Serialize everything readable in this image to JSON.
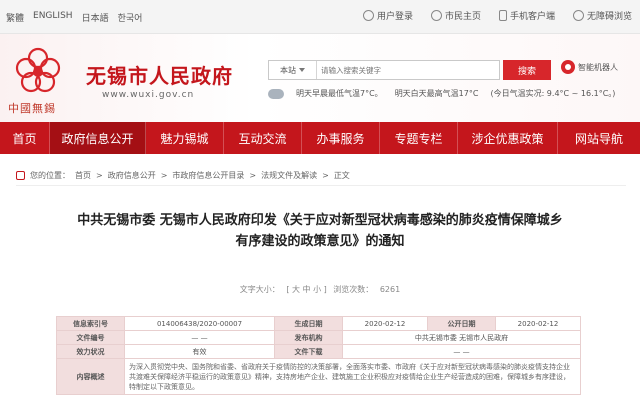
{
  "topbar": {
    "languages": [
      "繁體",
      "ENGLISH",
      "日本語",
      "한국어"
    ],
    "links": [
      {
        "label": "用户登录",
        "icon": "user-icon"
      },
      {
        "label": "市民主页",
        "icon": "home-icon"
      },
      {
        "label": "手机客户端",
        "icon": "phone-icon"
      },
      {
        "label": "无障碍浏览",
        "icon": "accessibility-icon"
      }
    ]
  },
  "header": {
    "logo_script": "中國無錫",
    "site_name": "无锡市人民政府",
    "site_url": "www.wuxi.gov.cn",
    "search_scope": "本站",
    "search_placeholder": "请输入搜索关键字",
    "search_button": "搜索",
    "robot_label": "智能机器人",
    "weather": [
      "明天早晨最低气温7°C。",
      "明天白天最高气温17°C",
      "(今日气温实况: 9.4°C ~ 16.1°C。)"
    ]
  },
  "nav": [
    {
      "label": "首页",
      "active": false
    },
    {
      "label": "政府信息公开",
      "active": true
    },
    {
      "label": "魅力锡城",
      "active": false
    },
    {
      "label": "互动交流",
      "active": false
    },
    {
      "label": "办事服务",
      "active": false
    },
    {
      "label": "专题专栏",
      "active": false
    },
    {
      "label": "涉企优惠政策",
      "active": false
    },
    {
      "label": "网站导航",
      "active": false
    }
  ],
  "breadcrumb": {
    "prefix": "您的位置：",
    "items": [
      "首页",
      "政府信息公开",
      "市政府信息公开目录",
      "法规文件及解读",
      "正文"
    ],
    "separator": ">"
  },
  "article": {
    "title_line1": "中共无锡市委 无锡市人民政府印发《关于应对新型冠状病毒感染的肺炎疫情保障城乡",
    "title_line2": "有序建设的政策意见》的通知",
    "font_size_label": "文字大小：",
    "font_sizes": "[ 大 中 小 ]",
    "views_label": "浏览次数：",
    "views": "6261"
  },
  "info_table": {
    "index_label": "信息索引号",
    "index_value": "014006438/2020-00007",
    "date_label": "生成日期",
    "date_value": "2020-02-12",
    "publish_label": "公开日期",
    "publish_value": "2020-02-12",
    "docno_label": "文件编号",
    "docno_value": "— —",
    "org_label": "发布机构",
    "org_value": "中共无锡市委 无锡市人民政府",
    "status_label": "效力状况",
    "status_value": "有效",
    "dept_label": "文件下载",
    "dept_value": "— —",
    "summary_label": "内容概述",
    "summary_value": "为深入贯彻党中央、国务院和省委、省政府关于疫情防控的决策部署，全面落实市委、市政府《关于应对新型冠状病毒感染的肺炎疫情支持企业共渡难关保障经济平稳运行的政策意见》精神，支持房地产企业、建筑施工企业积极应对疫情给企业生产经营造成的困难，保障城乡有序建设，特制定以下政策意见。"
  },
  "colors": {
    "brand_red": "#c4161c",
    "nav_active": "#a40f14",
    "label_bg": "#f2dede"
  }
}
